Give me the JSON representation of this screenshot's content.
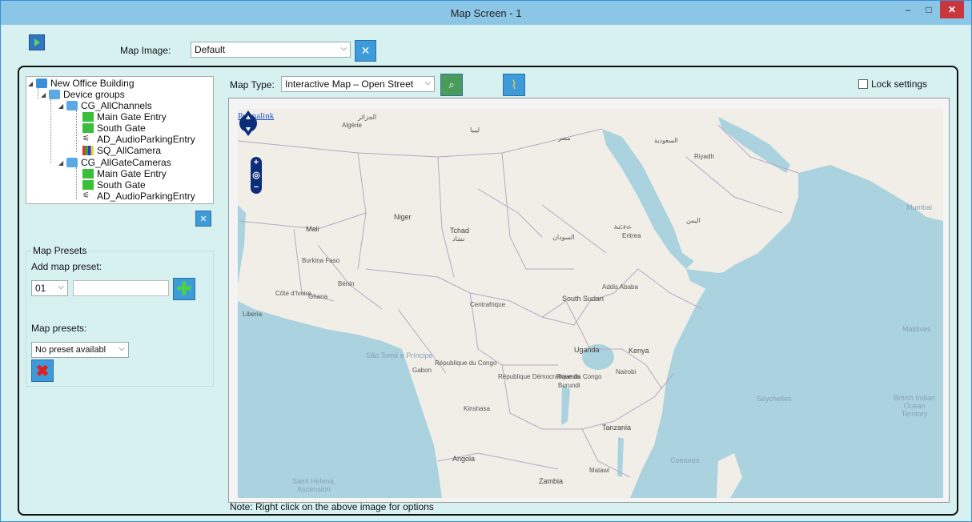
{
  "window": {
    "title": "Map Screen - 1",
    "minimize_glyph": "–",
    "maximize_glyph": "□",
    "close_glyph": "✕"
  },
  "toolbar": {
    "map_image_label": "Map Image:",
    "map_image_value": "Default"
  },
  "tree": {
    "root": "New Office Building",
    "group_root": "Device groups",
    "groups": [
      {
        "label": "CG_AllChannels",
        "children": [
          "Main Gate Entry",
          "South Gate",
          "AD_AudioParkingEntry",
          "SQ_AllCamera"
        ]
      },
      {
        "label": "CG_AllGateCameras",
        "children": [
          "Main Gate Entry",
          "South Gate",
          "AD_AudioParkingEntry"
        ]
      }
    ]
  },
  "presets": {
    "title": "Map Presets",
    "add_label": "Add map preset:",
    "number_value": "01",
    "name_value": "",
    "list_label": "Map presets:",
    "list_value": "No preset availabl"
  },
  "map_controls": {
    "type_label": "Map Type:",
    "type_value": "Interactive Map – Open Street",
    "lock_label": "Lock settings",
    "lock_checked": false
  },
  "map": {
    "permalink": "Permalink",
    "labels": [
      "الجزائر",
      "Algérie",
      "ليبيا",
      "مصر",
      "السعودية",
      "Riyadh",
      "Mali",
      "Niger",
      "Tchad",
      "تشاد",
      "السودان",
      "Eritrea",
      "ኤርትራ",
      "Burkina Faso",
      "Bénin",
      "Côte d'Ivoire",
      "Ghana",
      "Liberia",
      "Centrafrique",
      "South Sudan",
      "Addis Ababa",
      "اليمن",
      "Mumbai",
      "Maldives",
      "São Tomé e Príncipe",
      "Gabon",
      "République du Congo",
      "République Démocratique du Congo",
      "Uganda",
      "Kenya",
      "Nairobi",
      "Rwanda",
      "Burundi",
      "Tanzania",
      "Seychelles",
      "British Indian Ocean Territory",
      "Angola",
      "Zambia",
      "Malawi",
      "Comores",
      "Saint Helena, Ascension",
      "Kinshasa"
    ]
  },
  "note": "Note: Right click on the above image for options"
}
